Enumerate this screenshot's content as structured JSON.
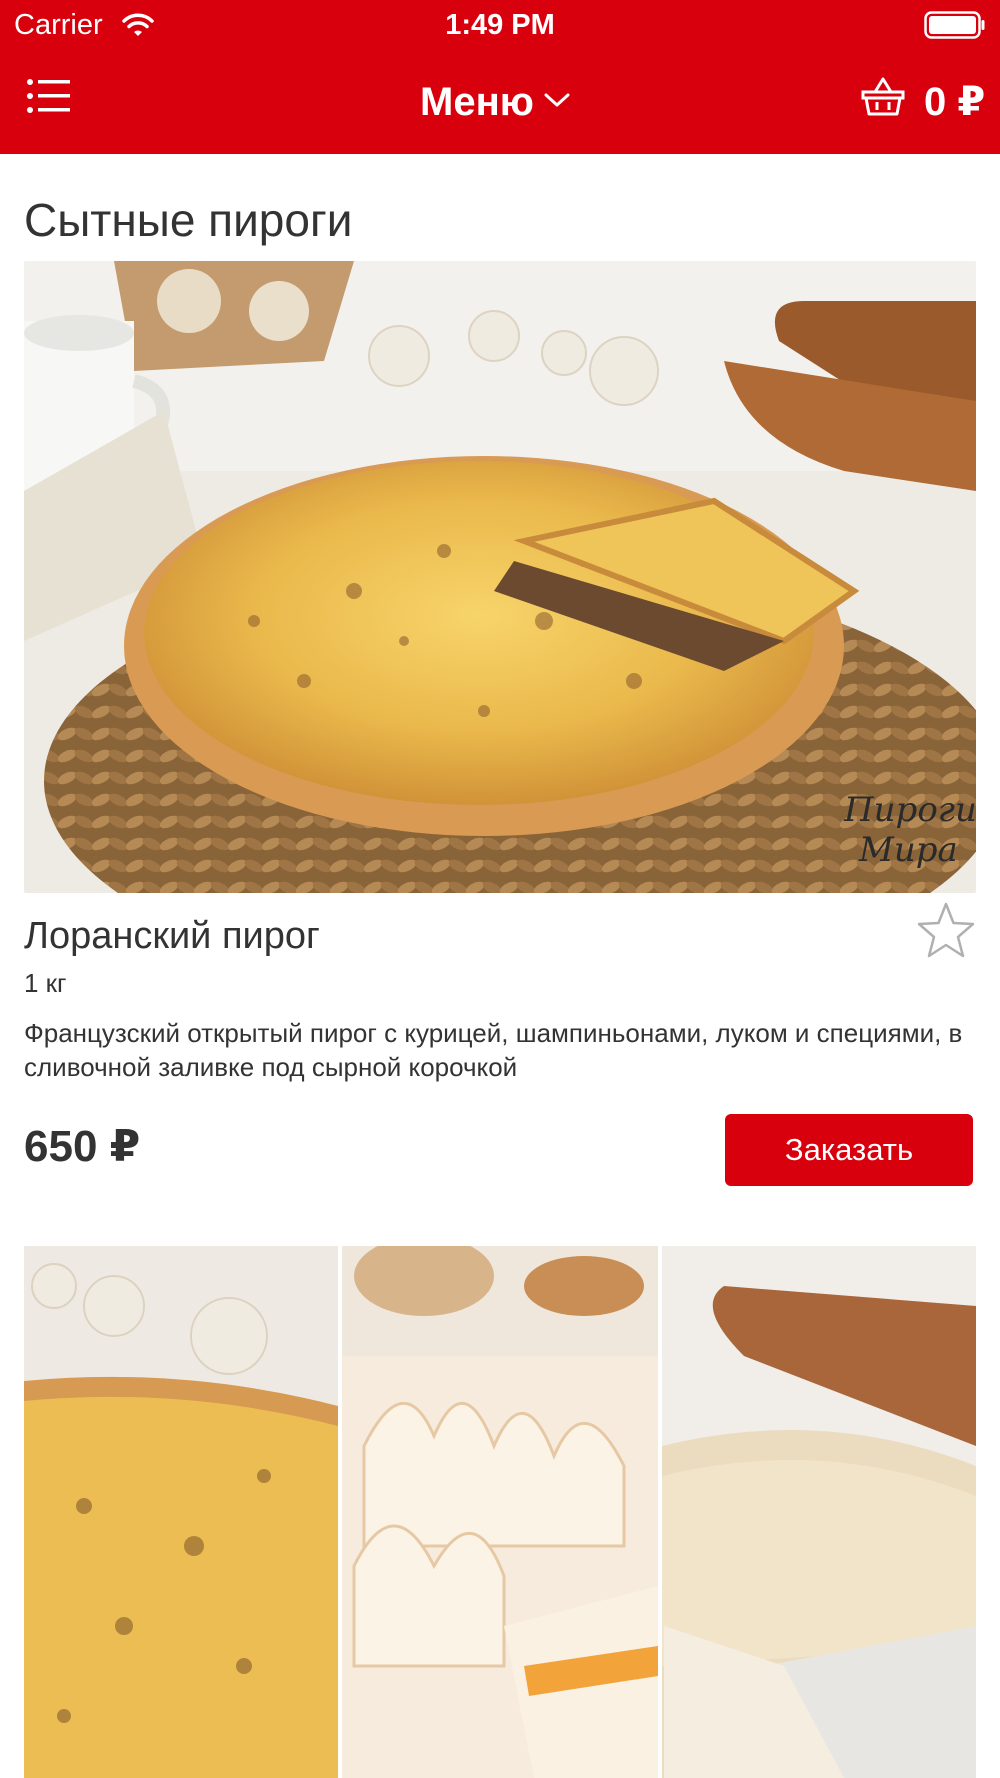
{
  "status_bar": {
    "carrier": "Carrier",
    "time": "1:49 PM"
  },
  "nav": {
    "title": "Меню",
    "cart_total": "0 ₽"
  },
  "section": {
    "title": "Сытные пироги"
  },
  "product": {
    "title": "Лоранский пирог",
    "weight": "1 кг",
    "description": "Французский открытый пирог с курицей, шампиньонами, луком и специями, в сливочной заливке под сырной корочкой",
    "price": "650 ₽",
    "order_label": "Заказать",
    "photo_watermark": "Пироги Мира"
  },
  "colors": {
    "brand_red": "#d9000d",
    "text": "#333333"
  },
  "icons": [
    "wifi-icon",
    "battery-icon",
    "list-menu-icon",
    "chevron-down-icon",
    "basket-icon",
    "star-icon"
  ]
}
